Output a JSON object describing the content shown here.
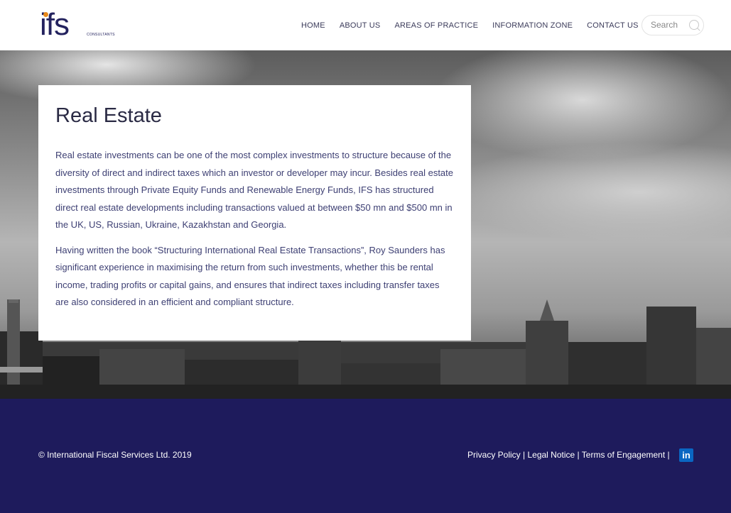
{
  "brand": {
    "logo_text": "ifs",
    "logo_sub": "CONSULTANTS"
  },
  "nav": {
    "items": [
      "HOME",
      "ABOUT US",
      "AREAS OF PRACTICE",
      "INFORMATION ZONE",
      "CONTACT US"
    ]
  },
  "search": {
    "placeholder": "Search"
  },
  "content": {
    "title": "Real Estate",
    "paragraph1": "Real estate investments can be one of the most complex investments to structure because of the diversity of direct and indirect taxes which an investor or developer may incur. Besides real estate investments through Private Equity Funds and Renewable Energy Funds, IFS has structured direct real estate developments including transactions valued at between $50 mn and $500 mn in the UK, US, Russian, Ukraine, Kazakhstan and Georgia.",
    "paragraph2": "Having written the book “Structuring International Real Estate Transactions”, Roy Saunders has significant experience in maximising the return from such investments, whether this be rental income, trading profits or capital gains, and ensures that indirect taxes including transfer taxes are also considered in an efficient and compliant structure."
  },
  "footer": {
    "copyright": "© International Fiscal Services Ltd. 2019",
    "links": [
      "Privacy Policy",
      "Legal Notice",
      "Terms of Engagement"
    ],
    "separator": " | ",
    "linkedin_label": "in"
  },
  "colors": {
    "navy": "#1e1b5c",
    "accent": "#e8891b",
    "linkedin": "#0a66c2"
  }
}
